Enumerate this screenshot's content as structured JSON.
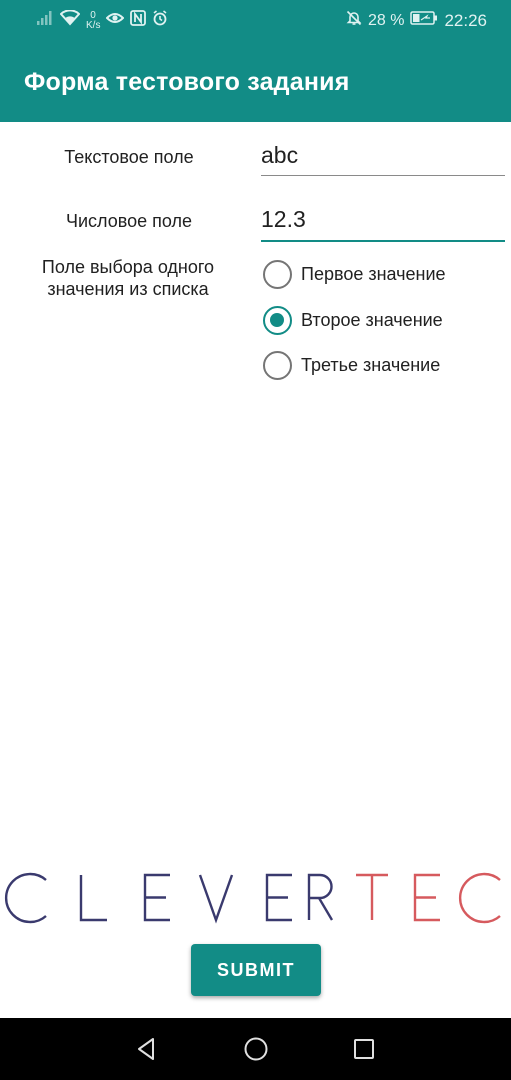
{
  "status_bar": {
    "netspeed_value": "0",
    "netspeed_unit": "K/s",
    "battery_pct": "28 %",
    "time": "22:26",
    "icons": [
      "signal-icon",
      "wifi-icon",
      "eye-icon",
      "nfc-icon",
      "alarm-icon",
      "mute-icon",
      "battery-icon"
    ]
  },
  "app_bar": {
    "title": "Форма тестового задания"
  },
  "form": {
    "text_field": {
      "label": "Текстовое поле",
      "value": "abc"
    },
    "number_field": {
      "label": "Числовое поле",
      "value": "12.3"
    },
    "choice": {
      "label_line1": "Поле выбора одного",
      "label_line2": "значения из списка",
      "options": [
        {
          "label": "Первое значение",
          "checked": false
        },
        {
          "label": "Второе значение",
          "checked": true
        },
        {
          "label": "Третье значение",
          "checked": false
        }
      ]
    }
  },
  "logo": {
    "text_a": "CLEVER",
    "text_b": "TEC"
  },
  "submit": {
    "label": "SUBMIT"
  },
  "nav_bar": {
    "icons": [
      "back-icon",
      "home-icon",
      "recents-icon"
    ]
  },
  "colors": {
    "primary": "#128c86",
    "logo_primary": "#3a3a6e",
    "logo_accent": "#d65a5e"
  }
}
